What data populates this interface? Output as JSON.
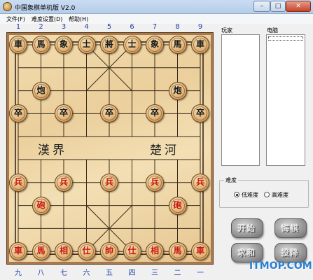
{
  "window": {
    "title": "中国象棋单机版 V2.0",
    "minimize": "–",
    "maximize": "□",
    "close": "✕"
  },
  "menu": [
    "文件(F)",
    "难度设置(D)",
    "帮助(H)"
  ],
  "coords_top": [
    "1",
    "2",
    "3",
    "4",
    "5",
    "6",
    "7",
    "8",
    "9"
  ],
  "coords_bottom": [
    "九",
    "八",
    "七",
    "六",
    "五",
    "四",
    "三",
    "二",
    "一"
  ],
  "river": {
    "left": "漢界",
    "right": "楚河"
  },
  "pieces": [
    {
      "t": "車",
      "side": "black",
      "c": 0,
      "r": 0
    },
    {
      "t": "馬",
      "side": "black",
      "c": 1,
      "r": 0
    },
    {
      "t": "象",
      "side": "black",
      "c": 2,
      "r": 0
    },
    {
      "t": "士",
      "side": "black",
      "c": 3,
      "r": 0
    },
    {
      "t": "將",
      "side": "black",
      "c": 4,
      "r": 0
    },
    {
      "t": "士",
      "side": "black",
      "c": 5,
      "r": 0
    },
    {
      "t": "象",
      "side": "black",
      "c": 6,
      "r": 0
    },
    {
      "t": "馬",
      "side": "black",
      "c": 7,
      "r": 0
    },
    {
      "t": "車",
      "side": "black",
      "c": 8,
      "r": 0
    },
    {
      "t": "炮",
      "side": "black",
      "c": 1,
      "r": 2
    },
    {
      "t": "炮",
      "side": "black",
      "c": 7,
      "r": 2
    },
    {
      "t": "卒",
      "side": "black",
      "c": 0,
      "r": 3
    },
    {
      "t": "卒",
      "side": "black",
      "c": 2,
      "r": 3
    },
    {
      "t": "卒",
      "side": "black",
      "c": 4,
      "r": 3
    },
    {
      "t": "卒",
      "side": "black",
      "c": 6,
      "r": 3
    },
    {
      "t": "卒",
      "side": "black",
      "c": 8,
      "r": 3
    },
    {
      "t": "兵",
      "side": "red",
      "c": 0,
      "r": 6
    },
    {
      "t": "兵",
      "side": "red",
      "c": 2,
      "r": 6
    },
    {
      "t": "兵",
      "side": "red",
      "c": 4,
      "r": 6
    },
    {
      "t": "兵",
      "side": "red",
      "c": 6,
      "r": 6
    },
    {
      "t": "兵",
      "side": "red",
      "c": 8,
      "r": 6
    },
    {
      "t": "砲",
      "side": "red",
      "c": 1,
      "r": 7
    },
    {
      "t": "砲",
      "side": "red",
      "c": 7,
      "r": 7
    },
    {
      "t": "車",
      "side": "red",
      "c": 0,
      "r": 9
    },
    {
      "t": "馬",
      "side": "red",
      "c": 1,
      "r": 9
    },
    {
      "t": "相",
      "side": "red",
      "c": 2,
      "r": 9
    },
    {
      "t": "仕",
      "side": "red",
      "c": 3,
      "r": 9
    },
    {
      "t": "帥",
      "side": "red",
      "c": 4,
      "r": 9
    },
    {
      "t": "仕",
      "side": "red",
      "c": 5,
      "r": 9
    },
    {
      "t": "相",
      "side": "red",
      "c": 6,
      "r": 9
    },
    {
      "t": "馬",
      "side": "red",
      "c": 7,
      "r": 9
    },
    {
      "t": "車",
      "side": "red",
      "c": 8,
      "r": 9
    }
  ],
  "panels": {
    "player_label": "玩家",
    "computer_label": "电脑"
  },
  "difficulty": {
    "title": "难度",
    "options": [
      "低难度",
      "高难度"
    ],
    "selected": 0
  },
  "buttons": {
    "start": "开始",
    "undo": "悔棋",
    "admit": "求和",
    "resign": "投降"
  },
  "watermark": "ITMOP.COM",
  "colors": {
    "red_piece": "#c8140f",
    "black_piece": "#1a1a1a",
    "board": "#ebcf9c",
    "coords": "#1e3fa8"
  }
}
